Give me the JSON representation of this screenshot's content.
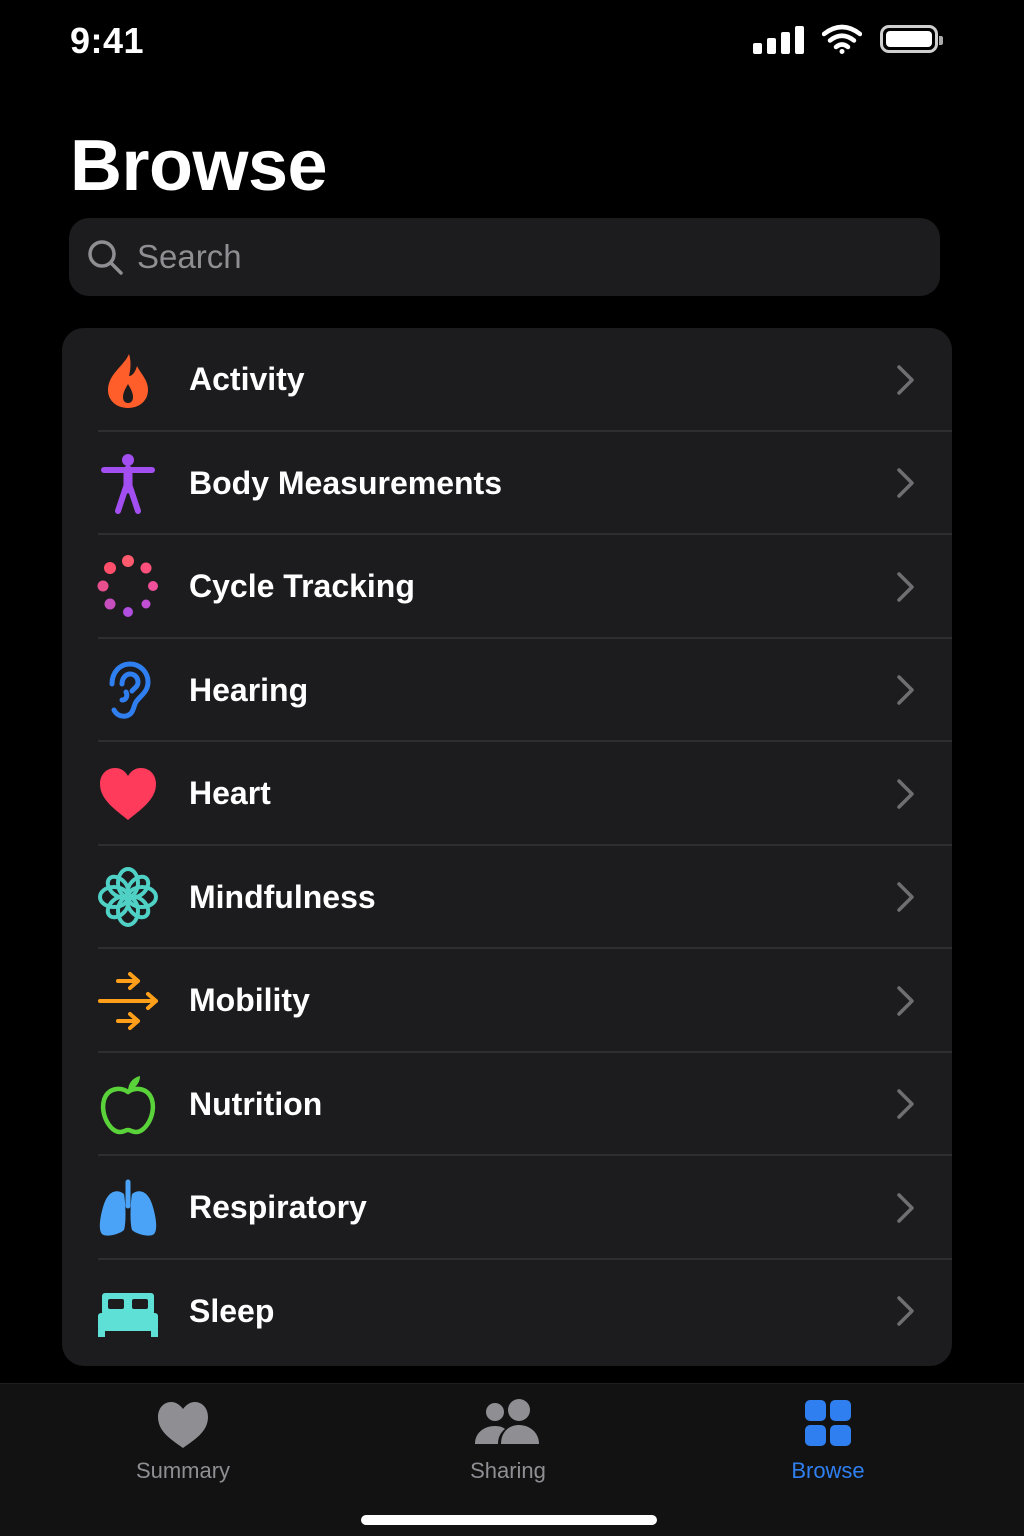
{
  "status_bar": {
    "time": "9:41"
  },
  "page": {
    "title": "Browse"
  },
  "search": {
    "placeholder": "Search",
    "value": ""
  },
  "categories": [
    {
      "label": "Activity",
      "icon": "flame-icon",
      "color": "#ff5e2b"
    },
    {
      "label": "Body Measurements",
      "icon": "figure-icon",
      "color": "#a34ef0"
    },
    {
      "label": "Cycle Tracking",
      "icon": "cycle-dots-icon",
      "color": "#ff4f7b"
    },
    {
      "label": "Hearing",
      "icon": "ear-icon",
      "color": "#2f7ff0"
    },
    {
      "label": "Heart",
      "icon": "heart-icon",
      "color": "#ff3b5c"
    },
    {
      "label": "Mindfulness",
      "icon": "flower-icon",
      "color": "#4fd1c5"
    },
    {
      "label": "Mobility",
      "icon": "arrows-icon",
      "color": "#ff9f1a"
    },
    {
      "label": "Nutrition",
      "icon": "apple-icon",
      "color": "#5ad33b"
    },
    {
      "label": "Respiratory",
      "icon": "lungs-icon",
      "color": "#4aa3f7"
    },
    {
      "label": "Sleep",
      "icon": "bed-icon",
      "color": "#5ee0d6"
    }
  ],
  "tab_bar": {
    "tabs": [
      {
        "label": "Summary",
        "icon": "heart-fill-icon",
        "active": false
      },
      {
        "label": "Sharing",
        "icon": "people-icon",
        "active": false
      },
      {
        "label": "Browse",
        "icon": "grid-icon",
        "active": true
      }
    ],
    "active_color": "#2f7ff0",
    "inactive_color": "#8e8e93"
  }
}
